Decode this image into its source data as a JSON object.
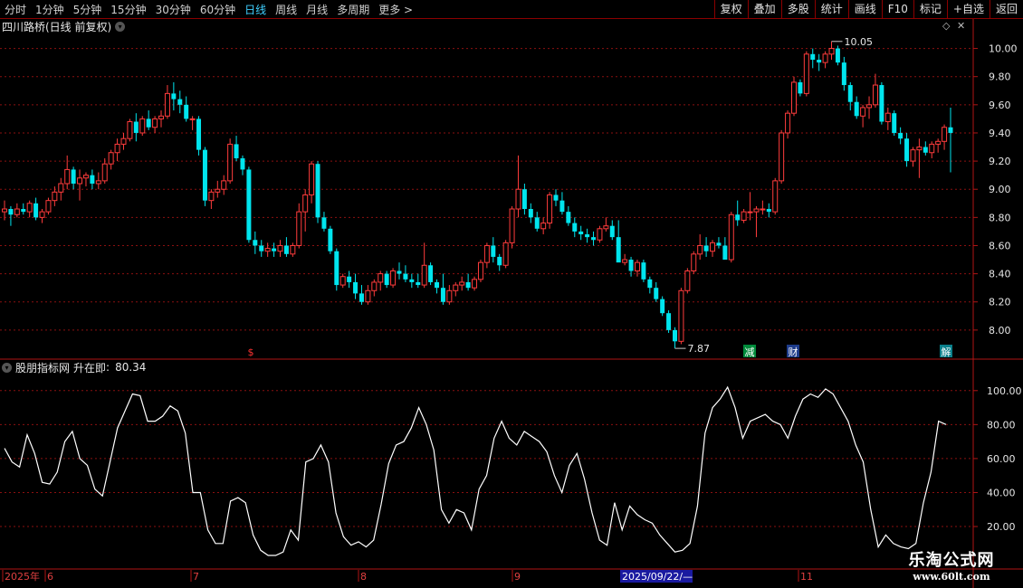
{
  "toolbar": {
    "periods": [
      "分时",
      "1分钟",
      "5分钟",
      "15分钟",
      "30分钟",
      "60分钟",
      "日线",
      "周线",
      "月线",
      "多周期",
      "更多 >"
    ],
    "active_period": "日线",
    "right_buttons": [
      "复权",
      "叠加",
      "多股",
      "统计",
      "画线",
      "F10",
      "标记",
      "+自选",
      "返回"
    ]
  },
  "main_panel": {
    "title": "四川路桥(日线 前复权)",
    "high_label": "10.05",
    "low_label": "7.87",
    "price_axis": [
      "10.00",
      "9.80",
      "9.60",
      "9.40",
      "9.20",
      "9.00",
      "8.80",
      "8.60",
      "8.40",
      "8.20",
      "8.00"
    ],
    "markers": [
      {
        "text": "$",
        "color": "#ff3333"
      },
      {
        "text": "减",
        "color": "#ffffff",
        "bg": "#008a3a"
      },
      {
        "text": "财",
        "color": "#ffffff",
        "bg": "#1d3b8a"
      },
      {
        "text": "解",
        "color": "#ffffff",
        "bg": "#0a7f8a"
      }
    ]
  },
  "indicator_panel": {
    "name": "股朋指标网",
    "line_name": "升在即",
    "value": "80.34",
    "axis": [
      "100.00",
      "80.00",
      "60.00",
      "40.00",
      "20.00"
    ]
  },
  "date_axis": {
    "labels": [
      "2025年",
      "6",
      "7",
      "8",
      "9",
      "2025/09/22/—",
      "11"
    ]
  },
  "watermark": {
    "line1": "乐淘公式网",
    "line2": "www.60lt.com"
  },
  "colors": {
    "up": "#ff3c3c",
    "down": "#00e5ee",
    "grid": "#8b1010",
    "axis": "#b01515",
    "line": "#ffffff"
  },
  "chart_data": {
    "type": "candlestick",
    "candles": [
      [
        8.84,
        8.92,
        8.78,
        8.86
      ],
      [
        8.86,
        8.88,
        8.74,
        8.82
      ],
      [
        8.82,
        8.9,
        8.8,
        8.86
      ],
      [
        8.86,
        8.9,
        8.82,
        8.84
      ],
      [
        8.84,
        8.92,
        8.8,
        8.9
      ],
      [
        8.9,
        8.94,
        8.78,
        8.8
      ],
      [
        8.8,
        8.86,
        8.76,
        8.84
      ],
      [
        8.84,
        8.94,
        8.82,
        8.92
      ],
      [
        8.92,
        9.02,
        8.88,
        8.98
      ],
      [
        8.98,
        9.08,
        8.92,
        9.04
      ],
      [
        9.04,
        9.24,
        9.0,
        9.14
      ],
      [
        9.14,
        9.16,
        9.0,
        9.04
      ],
      [
        9.04,
        9.14,
        8.92,
        9.08
      ],
      [
        9.08,
        9.12,
        9.02,
        9.1
      ],
      [
        9.1,
        9.14,
        9.0,
        9.04
      ],
      [
        9.04,
        9.12,
        9.0,
        9.06
      ],
      [
        9.06,
        9.22,
        9.04,
        9.18
      ],
      [
        9.18,
        9.28,
        9.14,
        9.26
      ],
      [
        9.26,
        9.36,
        9.2,
        9.32
      ],
      [
        9.32,
        9.4,
        9.28,
        9.36
      ],
      [
        9.36,
        9.5,
        9.34,
        9.48
      ],
      [
        9.48,
        9.54,
        9.34,
        9.4
      ],
      [
        9.4,
        9.52,
        9.38,
        9.5
      ],
      [
        9.5,
        9.56,
        9.42,
        9.44
      ],
      [
        9.44,
        9.52,
        9.4,
        9.5
      ],
      [
        9.5,
        9.56,
        9.44,
        9.52
      ],
      [
        9.52,
        9.74,
        9.5,
        9.68
      ],
      [
        9.68,
        9.76,
        9.56,
        9.64
      ],
      [
        9.64,
        9.7,
        9.54,
        9.6
      ],
      [
        9.6,
        9.66,
        9.48,
        9.5
      ],
      [
        9.5,
        9.52,
        9.42,
        9.5
      ],
      [
        9.5,
        9.52,
        9.24,
        9.28
      ],
      [
        9.28,
        9.3,
        8.88,
        8.92
      ],
      [
        8.92,
        9.0,
        8.86,
        8.98
      ],
      [
        8.98,
        9.06,
        8.94,
        9.0
      ],
      [
        9.0,
        9.1,
        8.96,
        9.06
      ],
      [
        9.06,
        9.36,
        9.04,
        9.32
      ],
      [
        9.32,
        9.38,
        9.2,
        9.22
      ],
      [
        9.22,
        9.24,
        9.1,
        9.14
      ],
      [
        9.14,
        9.16,
        8.62,
        8.64
      ],
      [
        8.64,
        8.7,
        8.54,
        8.6
      ],
      [
        8.6,
        8.64,
        8.52,
        8.56
      ],
      [
        8.56,
        8.62,
        8.52,
        8.58
      ],
      [
        8.58,
        8.62,
        8.52,
        8.56
      ],
      [
        8.56,
        8.64,
        8.52,
        8.6
      ],
      [
        8.6,
        8.66,
        8.52,
        8.54
      ],
      [
        8.54,
        8.62,
        8.52,
        8.6
      ],
      [
        8.6,
        8.9,
        8.58,
        8.84
      ],
      [
        8.84,
        9.0,
        8.7,
        8.96
      ],
      [
        8.96,
        9.2,
        8.9,
        9.18
      ],
      [
        9.18,
        9.2,
        8.76,
        8.8
      ],
      [
        8.8,
        8.84,
        8.7,
        8.72
      ],
      [
        8.72,
        8.74,
        8.54,
        8.56
      ],
      [
        8.56,
        8.58,
        8.28,
        8.32
      ],
      [
        8.32,
        8.4,
        8.3,
        8.38
      ],
      [
        8.38,
        8.42,
        8.3,
        8.34
      ],
      [
        8.34,
        8.4,
        8.22,
        8.26
      ],
      [
        8.26,
        8.32,
        8.18,
        8.2
      ],
      [
        8.2,
        8.32,
        8.18,
        8.28
      ],
      [
        8.28,
        8.36,
        8.24,
        8.34
      ],
      [
        8.34,
        8.42,
        8.28,
        8.4
      ],
      [
        8.4,
        8.42,
        8.3,
        8.32
      ],
      [
        8.32,
        8.44,
        8.3,
        8.42
      ],
      [
        8.42,
        8.48,
        8.36,
        8.4
      ],
      [
        8.4,
        8.46,
        8.34,
        8.36
      ],
      [
        8.36,
        8.4,
        8.3,
        8.34
      ],
      [
        8.34,
        8.4,
        8.3,
        8.32
      ],
      [
        8.32,
        8.62,
        8.3,
        8.46
      ],
      [
        8.46,
        8.48,
        8.32,
        8.34
      ],
      [
        8.34,
        8.36,
        8.26,
        8.3
      ],
      [
        8.3,
        8.4,
        8.18,
        8.2
      ],
      [
        8.2,
        8.32,
        8.18,
        8.28
      ],
      [
        8.28,
        8.34,
        8.24,
        8.32
      ],
      [
        8.32,
        8.38,
        8.28,
        8.34
      ],
      [
        8.34,
        8.4,
        8.28,
        8.3
      ],
      [
        8.3,
        8.38,
        8.28,
        8.36
      ],
      [
        8.36,
        8.5,
        8.34,
        8.48
      ],
      [
        8.48,
        8.62,
        8.44,
        8.6
      ],
      [
        8.6,
        8.66,
        8.48,
        8.52
      ],
      [
        8.52,
        8.54,
        8.42,
        8.46
      ],
      [
        8.46,
        8.64,
        8.44,
        8.62
      ],
      [
        8.62,
        8.88,
        8.58,
        8.86
      ],
      [
        8.86,
        9.24,
        8.8,
        9.0
      ],
      [
        9.0,
        9.04,
        8.82,
        8.86
      ],
      [
        8.86,
        8.9,
        8.76,
        8.8
      ],
      [
        8.8,
        8.84,
        8.7,
        8.72
      ],
      [
        8.72,
        8.8,
        8.68,
        8.76
      ],
      [
        8.76,
        8.98,
        8.72,
        8.96
      ],
      [
        8.96,
        9.0,
        8.88,
        8.92
      ],
      [
        8.92,
        8.98,
        8.82,
        8.84
      ],
      [
        8.84,
        8.88,
        8.74,
        8.76
      ],
      [
        8.76,
        8.8,
        8.66,
        8.7
      ],
      [
        8.7,
        8.74,
        8.64,
        8.68
      ],
      [
        8.68,
        8.72,
        8.62,
        8.66
      ],
      [
        8.66,
        8.7,
        8.6,
        8.64
      ],
      [
        8.64,
        8.74,
        8.62,
        8.72
      ],
      [
        8.72,
        8.8,
        8.7,
        8.74
      ],
      [
        8.74,
        8.78,
        8.64,
        8.66
      ],
      [
        8.66,
        8.78,
        8.62,
        8.48
      ],
      [
        8.48,
        8.54,
        8.46,
        8.5
      ],
      [
        8.5,
        8.52,
        8.38,
        8.42
      ],
      [
        8.42,
        8.5,
        8.38,
        8.48
      ],
      [
        8.48,
        8.5,
        8.34,
        8.36
      ],
      [
        8.36,
        8.38,
        8.26,
        8.3
      ],
      [
        8.3,
        8.34,
        8.2,
        8.22
      ],
      [
        8.22,
        8.24,
        8.1,
        8.12
      ],
      [
        8.12,
        8.14,
        7.98,
        8.0
      ],
      [
        8.0,
        8.02,
        7.87,
        7.92
      ],
      [
        7.92,
        8.3,
        7.9,
        8.28
      ],
      [
        8.28,
        8.44,
        8.26,
        8.42
      ],
      [
        8.42,
        8.56,
        8.4,
        8.54
      ],
      [
        8.54,
        8.68,
        8.5,
        8.6
      ],
      [
        8.6,
        8.66,
        8.52,
        8.56
      ],
      [
        8.56,
        8.64,
        8.52,
        8.62
      ],
      [
        8.62,
        8.66,
        8.58,
        8.6
      ],
      [
        8.6,
        8.66,
        8.54,
        8.5
      ],
      [
        8.5,
        8.84,
        8.48,
        8.82
      ],
      [
        8.82,
        8.92,
        8.74,
        8.78
      ],
      [
        8.78,
        8.86,
        8.76,
        8.84
      ],
      [
        8.84,
        8.98,
        8.78,
        8.84
      ],
      [
        8.84,
        8.88,
        8.66,
        8.86
      ],
      [
        8.86,
        8.92,
        8.82,
        8.86
      ],
      [
        8.86,
        8.9,
        8.8,
        8.84
      ],
      [
        8.84,
        9.08,
        8.82,
        9.06
      ],
      [
        9.06,
        9.42,
        9.04,
        9.4
      ],
      [
        9.4,
        9.56,
        9.36,
        9.54
      ],
      [
        9.54,
        9.8,
        9.52,
        9.76
      ],
      [
        9.76,
        9.78,
        9.66,
        9.68
      ],
      [
        9.68,
        9.98,
        9.66,
        9.96
      ],
      [
        9.96,
        10.0,
        9.86,
        9.92
      ],
      [
        9.92,
        9.96,
        9.84,
        9.9
      ],
      [
        9.9,
        9.98,
        9.86,
        9.96
      ],
      [
        9.96,
        10.05,
        9.92,
        10.0
      ],
      [
        10.0,
        10.02,
        9.88,
        9.9
      ],
      [
        9.9,
        9.94,
        9.7,
        9.74
      ],
      [
        9.74,
        9.76,
        9.56,
        9.62
      ],
      [
        9.62,
        9.66,
        9.5,
        9.52
      ],
      [
        9.52,
        9.6,
        9.44,
        9.58
      ],
      [
        9.58,
        9.66,
        9.5,
        9.6
      ],
      [
        9.6,
        9.82,
        9.58,
        9.74
      ],
      [
        9.74,
        9.76,
        9.46,
        9.48
      ],
      [
        9.48,
        9.58,
        9.42,
        9.54
      ],
      [
        9.54,
        9.56,
        9.38,
        9.4
      ],
      [
        9.4,
        9.44,
        9.32,
        9.36
      ],
      [
        9.36,
        9.4,
        9.16,
        9.2
      ],
      [
        9.2,
        9.3,
        9.16,
        9.28
      ],
      [
        9.28,
        9.36,
        9.08,
        9.3
      ],
      [
        9.3,
        9.34,
        9.24,
        9.26
      ],
      [
        9.26,
        9.34,
        9.22,
        9.32
      ],
      [
        9.32,
        9.36,
        9.26,
        9.34
      ],
      [
        9.34,
        9.46,
        9.28,
        9.44
      ],
      [
        9.44,
        9.58,
        9.12,
        9.4
      ]
    ],
    "indicator": [
      66,
      58,
      55,
      74,
      63,
      46,
      45,
      52,
      70,
      76,
      60,
      56,
      42,
      38,
      58,
      78,
      88,
      98,
      97,
      82,
      82,
      85,
      91,
      88,
      75,
      40,
      40,
      18,
      10,
      10,
      35,
      37,
      34,
      15,
      6,
      3,
      3,
      5,
      18,
      12,
      58,
      60,
      68,
      58,
      28,
      14,
      9,
      11,
      8,
      12,
      33,
      57,
      68,
      70,
      78,
      90,
      80,
      65,
      30,
      22,
      30,
      28,
      18,
      42,
      50,
      72,
      82,
      72,
      68,
      76,
      73,
      70,
      64,
      50,
      40,
      56,
      63,
      48,
      28,
      12,
      9,
      34,
      18,
      32,
      27,
      24,
      22,
      15,
      10,
      5,
      6,
      10,
      32,
      75,
      90,
      95,
      102,
      90,
      72,
      82,
      84,
      86,
      82,
      80,
      72,
      85,
      95,
      98,
      96,
      101,
      98,
      90,
      82,
      68,
      58,
      30,
      8,
      15,
      10,
      8,
      7,
      10,
      34,
      52,
      82,
      80
    ]
  }
}
